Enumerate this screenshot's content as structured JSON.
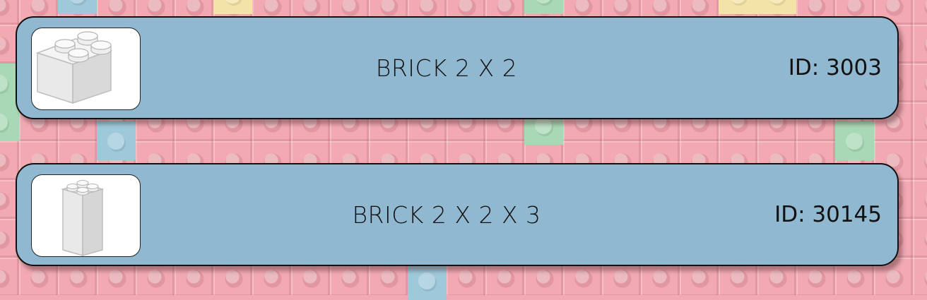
{
  "parts": [
    {
      "name": "BRICK 2 X 2",
      "id": "ID: 3003",
      "icon": "brick-2x2-icon"
    },
    {
      "name": "BRICK 2 X 2 X 3",
      "id": "ID: 30145",
      "icon": "brick-2x2x3-icon"
    }
  ],
  "colors": {
    "card_background": "#91b8d1",
    "page_background": "#f2a9b2",
    "text": "#111111"
  }
}
